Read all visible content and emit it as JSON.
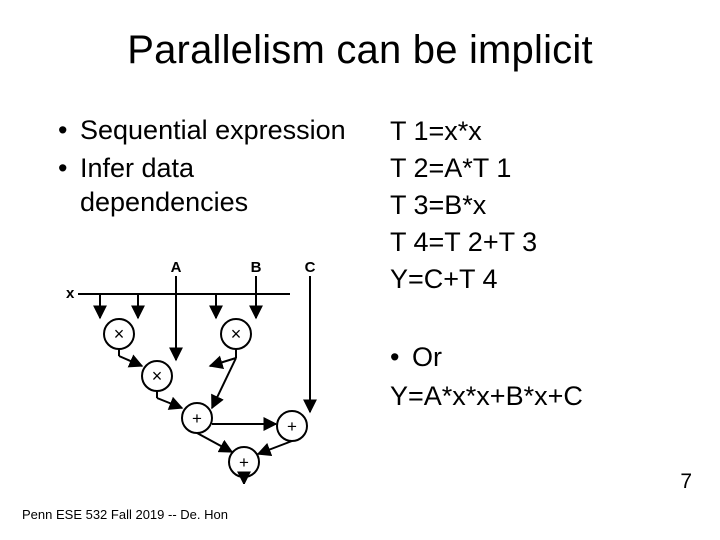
{
  "title": "Parallelism can be implicit",
  "left": {
    "bullets": [
      "Sequential expression",
      "Infer data dependencies"
    ]
  },
  "right": {
    "equations": [
      "T 1=x*x",
      "T 2=A*T 1",
      "T 3=B*x",
      "T 4=T 2+T 3",
      "Y=C+T 4"
    ],
    "or_label": "Or",
    "or_eq": "Y=A*x*x+B*x+C"
  },
  "diagram": {
    "x": "x",
    "A": "A",
    "B": "B",
    "C": "C"
  },
  "footer": "Penn ESE 532 Fall 2019 -- De. Hon",
  "page": "7"
}
